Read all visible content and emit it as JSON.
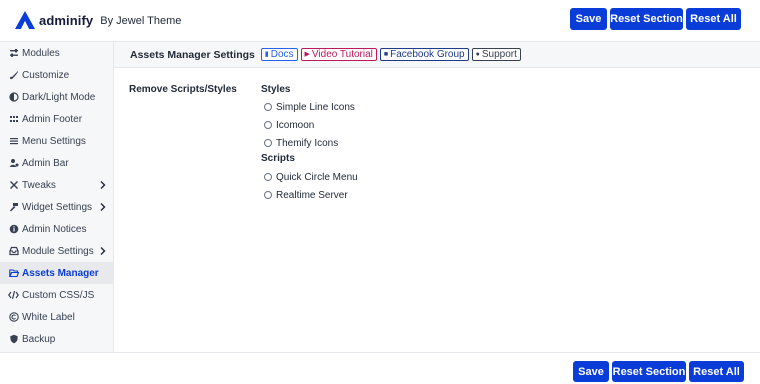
{
  "brand": {
    "name": "adminify",
    "byline": "By Jewel Theme",
    "accent_color": "#0a3dd8"
  },
  "toolbar": {
    "save_label": "Save",
    "reset_section_label": "Reset Section",
    "reset_all_label": "Reset All"
  },
  "sidebar": {
    "items": [
      {
        "label": "Modules",
        "icon": "sliders-icon"
      },
      {
        "label": "Customize",
        "icon": "paint-brush-icon"
      },
      {
        "label": "Dark/Light Mode",
        "icon": "half-circle-icon"
      },
      {
        "label": "Admin Footer",
        "icon": "grid-dots-icon"
      },
      {
        "label": "Menu Settings",
        "icon": "list-icon"
      },
      {
        "label": "Admin Bar",
        "icon": "user-gear-icon"
      },
      {
        "label": "Tweaks",
        "icon": "tools-icon"
      },
      {
        "label": "Widget Settings",
        "icon": "hammer-icon"
      },
      {
        "label": "Admin Notices",
        "icon": "info-circle-icon"
      },
      {
        "label": "Module Settings",
        "icon": "inbox-icon"
      },
      {
        "label": "Assets Manager",
        "icon": "folder-open-icon"
      },
      {
        "label": "Custom CSS/JS",
        "icon": "code-icon"
      },
      {
        "label": "White Label",
        "icon": "copyright-icon"
      },
      {
        "label": "Backup",
        "icon": "shield-icon"
      }
    ],
    "active": "Assets Manager"
  },
  "section": {
    "title": "Assets Manager Settings",
    "links": [
      {
        "label": "Docs",
        "icon": "doc-icon",
        "color": "#2563eb"
      },
      {
        "label": "Video Tutorial",
        "icon": "play-icon",
        "color": "#be185d"
      },
      {
        "label": "Facebook Group",
        "icon": "facebook-icon",
        "color": "#1e3a8a"
      },
      {
        "label": "Support",
        "icon": "support-icon",
        "color": "#374151"
      }
    ]
  },
  "main": {
    "field_label": "Remove Scripts/Styles",
    "styles_heading": "Styles",
    "styles": [
      "Simple Line Icons",
      "Icomoon",
      "Themify Icons"
    ],
    "scripts_heading": "Scripts",
    "scripts": [
      "Quick Circle Menu",
      "Realtime Server"
    ]
  }
}
